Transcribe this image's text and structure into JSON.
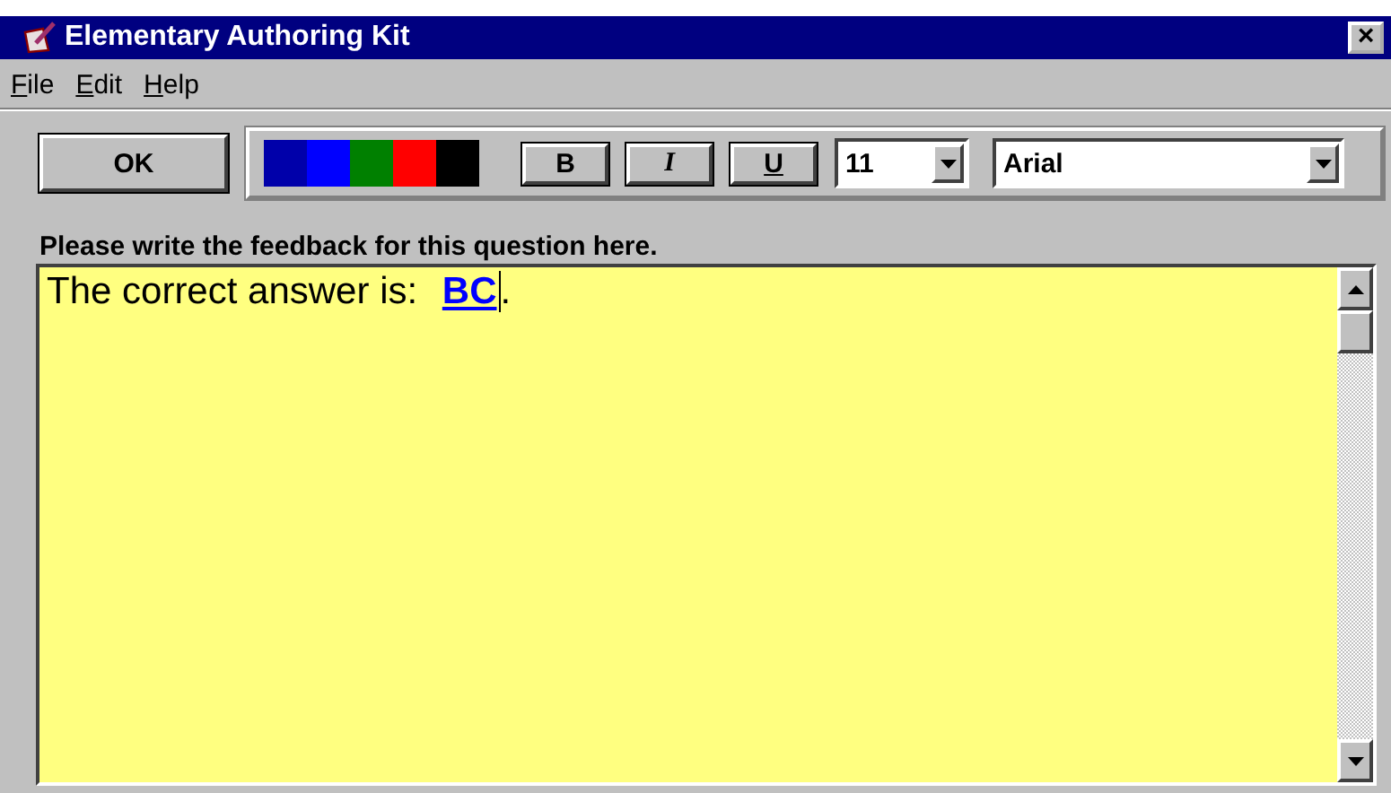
{
  "window": {
    "title": "Elementary Authoring Kit",
    "close": "×"
  },
  "menu": [
    {
      "label": "File"
    },
    {
      "label": "Edit"
    },
    {
      "label": "Help"
    }
  ],
  "toolbar": {
    "ok_button": "OK",
    "palette": [
      {
        "color": "#0000aa"
      },
      {
        "color": "#0000ff"
      },
      {
        "color": "#008000"
      },
      {
        "color": "#ff0000"
      },
      {
        "color": "#000000"
      }
    ],
    "format_buttons": [
      {
        "label": "B",
        "kind": "bold"
      },
      {
        "label": "I",
        "kind": "italic"
      },
      {
        "label": "U",
        "kind": "underline"
      }
    ],
    "size": {
      "value": "11"
    },
    "font": {
      "value": "Arial"
    }
  },
  "prompt": "Please write the feedback for this question here.",
  "editor": {
    "segments": [
      {
        "text": "The correct answer is: ",
        "kind": "plain"
      },
      {
        "text": "BC",
        "kind": "answer"
      },
      {
        "text": ".",
        "kind": "plain"
      }
    ]
  }
}
